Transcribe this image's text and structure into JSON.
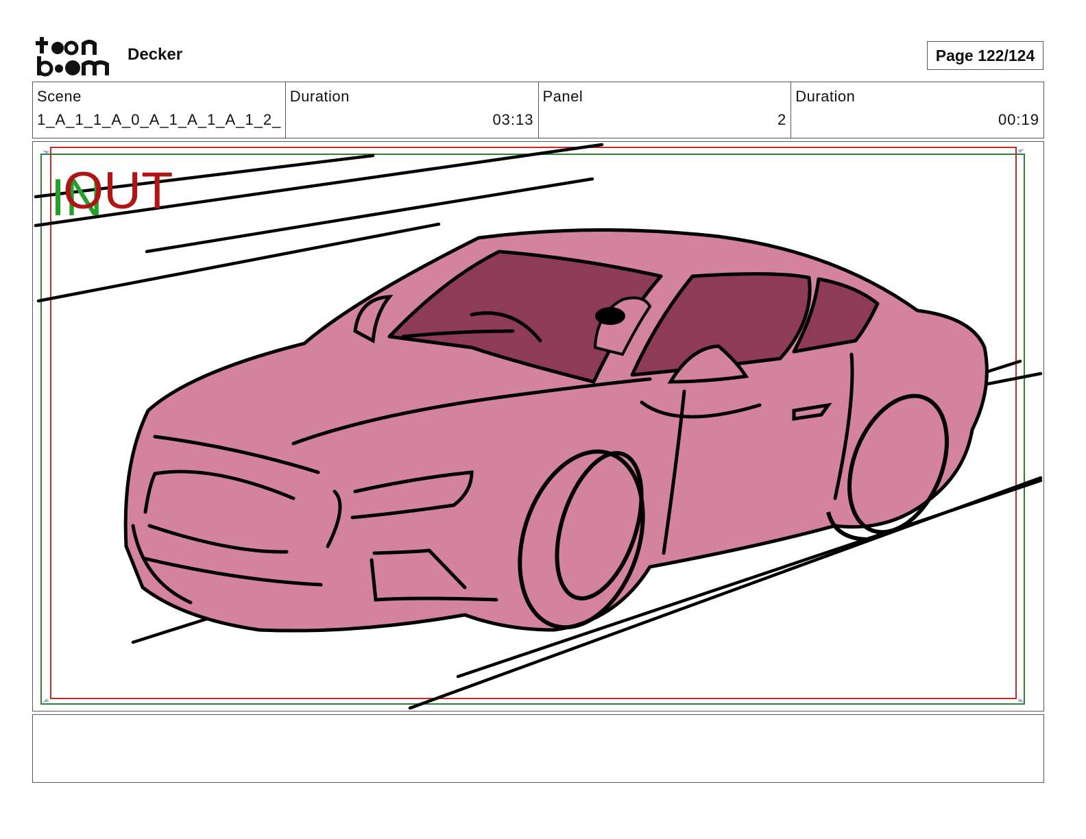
{
  "header": {
    "logo_text": "toon boom",
    "project_title": "Decker",
    "page_label": "Page 122/124"
  },
  "info": {
    "scene_label": "Scene",
    "scene_value": "1_A_1_1_A_0_A_1_A_1_A_1_2_",
    "scene_duration_label": "Duration",
    "scene_duration_value": "03:13",
    "panel_label": "Panel",
    "panel_value": "2",
    "panel_duration_label": "Duration",
    "panel_duration_value": "00:19"
  },
  "panel": {
    "in_marker": "IN",
    "out_marker": "OUT",
    "colors": {
      "car_fill": "#d4839e",
      "window_fill": "#8e3b57",
      "in_frame": "#2e7d32",
      "out_frame": "#c62828"
    }
  },
  "notes": {
    "text": ""
  }
}
